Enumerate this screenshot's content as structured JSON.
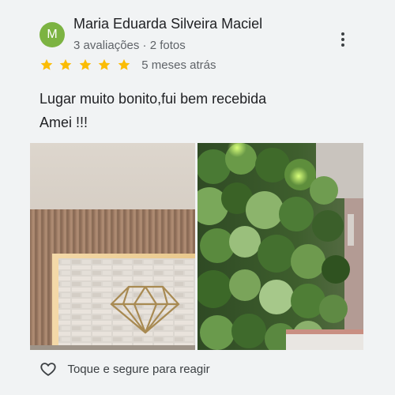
{
  "review": {
    "author_initial": "M",
    "author_name": "Maria Eduarda Silveira Maciel",
    "author_meta": "3 avaliações · 2 fotos",
    "rating": 5,
    "rating_max": 5,
    "date": "5 meses atrás",
    "text_line1": "Lugar muito bonito,fui bem recebida",
    "text_line2": "Amei !!!",
    "react_label": "Toque e segure para reagir"
  },
  "colors": {
    "avatar": "#7cb342",
    "star": "#fbbc04",
    "text_primary": "#202124",
    "text_secondary": "#5f6368",
    "background": "#f1f3f4"
  },
  "icons": {
    "more": "more-vert-icon",
    "star": "star-icon",
    "react": "heart-outline-icon"
  }
}
